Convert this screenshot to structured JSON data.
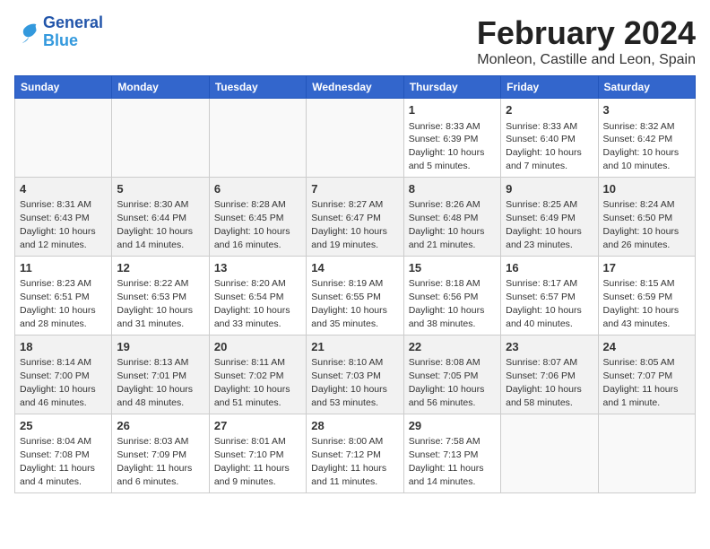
{
  "header": {
    "logo_text_line1": "General",
    "logo_text_line2": "Blue",
    "month": "February 2024",
    "location": "Monleon, Castille and Leon, Spain"
  },
  "weekdays": [
    "Sunday",
    "Monday",
    "Tuesday",
    "Wednesday",
    "Thursday",
    "Friday",
    "Saturday"
  ],
  "weeks": [
    [
      {
        "day": "",
        "info": ""
      },
      {
        "day": "",
        "info": ""
      },
      {
        "day": "",
        "info": ""
      },
      {
        "day": "",
        "info": ""
      },
      {
        "day": "1",
        "info": "Sunrise: 8:33 AM\nSunset: 6:39 PM\nDaylight: 10 hours\nand 5 minutes."
      },
      {
        "day": "2",
        "info": "Sunrise: 8:33 AM\nSunset: 6:40 PM\nDaylight: 10 hours\nand 7 minutes."
      },
      {
        "day": "3",
        "info": "Sunrise: 8:32 AM\nSunset: 6:42 PM\nDaylight: 10 hours\nand 10 minutes."
      }
    ],
    [
      {
        "day": "4",
        "info": "Sunrise: 8:31 AM\nSunset: 6:43 PM\nDaylight: 10 hours\nand 12 minutes."
      },
      {
        "day": "5",
        "info": "Sunrise: 8:30 AM\nSunset: 6:44 PM\nDaylight: 10 hours\nand 14 minutes."
      },
      {
        "day": "6",
        "info": "Sunrise: 8:28 AM\nSunset: 6:45 PM\nDaylight: 10 hours\nand 16 minutes."
      },
      {
        "day": "7",
        "info": "Sunrise: 8:27 AM\nSunset: 6:47 PM\nDaylight: 10 hours\nand 19 minutes."
      },
      {
        "day": "8",
        "info": "Sunrise: 8:26 AM\nSunset: 6:48 PM\nDaylight: 10 hours\nand 21 minutes."
      },
      {
        "day": "9",
        "info": "Sunrise: 8:25 AM\nSunset: 6:49 PM\nDaylight: 10 hours\nand 23 minutes."
      },
      {
        "day": "10",
        "info": "Sunrise: 8:24 AM\nSunset: 6:50 PM\nDaylight: 10 hours\nand 26 minutes."
      }
    ],
    [
      {
        "day": "11",
        "info": "Sunrise: 8:23 AM\nSunset: 6:51 PM\nDaylight: 10 hours\nand 28 minutes."
      },
      {
        "day": "12",
        "info": "Sunrise: 8:22 AM\nSunset: 6:53 PM\nDaylight: 10 hours\nand 31 minutes."
      },
      {
        "day": "13",
        "info": "Sunrise: 8:20 AM\nSunset: 6:54 PM\nDaylight: 10 hours\nand 33 minutes."
      },
      {
        "day": "14",
        "info": "Sunrise: 8:19 AM\nSunset: 6:55 PM\nDaylight: 10 hours\nand 35 minutes."
      },
      {
        "day": "15",
        "info": "Sunrise: 8:18 AM\nSunset: 6:56 PM\nDaylight: 10 hours\nand 38 minutes."
      },
      {
        "day": "16",
        "info": "Sunrise: 8:17 AM\nSunset: 6:57 PM\nDaylight: 10 hours\nand 40 minutes."
      },
      {
        "day": "17",
        "info": "Sunrise: 8:15 AM\nSunset: 6:59 PM\nDaylight: 10 hours\nand 43 minutes."
      }
    ],
    [
      {
        "day": "18",
        "info": "Sunrise: 8:14 AM\nSunset: 7:00 PM\nDaylight: 10 hours\nand 46 minutes."
      },
      {
        "day": "19",
        "info": "Sunrise: 8:13 AM\nSunset: 7:01 PM\nDaylight: 10 hours\nand 48 minutes."
      },
      {
        "day": "20",
        "info": "Sunrise: 8:11 AM\nSunset: 7:02 PM\nDaylight: 10 hours\nand 51 minutes."
      },
      {
        "day": "21",
        "info": "Sunrise: 8:10 AM\nSunset: 7:03 PM\nDaylight: 10 hours\nand 53 minutes."
      },
      {
        "day": "22",
        "info": "Sunrise: 8:08 AM\nSunset: 7:05 PM\nDaylight: 10 hours\nand 56 minutes."
      },
      {
        "day": "23",
        "info": "Sunrise: 8:07 AM\nSunset: 7:06 PM\nDaylight: 10 hours\nand 58 minutes."
      },
      {
        "day": "24",
        "info": "Sunrise: 8:05 AM\nSunset: 7:07 PM\nDaylight: 11 hours\nand 1 minute."
      }
    ],
    [
      {
        "day": "25",
        "info": "Sunrise: 8:04 AM\nSunset: 7:08 PM\nDaylight: 11 hours\nand 4 minutes."
      },
      {
        "day": "26",
        "info": "Sunrise: 8:03 AM\nSunset: 7:09 PM\nDaylight: 11 hours\nand 6 minutes."
      },
      {
        "day": "27",
        "info": "Sunrise: 8:01 AM\nSunset: 7:10 PM\nDaylight: 11 hours\nand 9 minutes."
      },
      {
        "day": "28",
        "info": "Sunrise: 8:00 AM\nSunset: 7:12 PM\nDaylight: 11 hours\nand 11 minutes."
      },
      {
        "day": "29",
        "info": "Sunrise: 7:58 AM\nSunset: 7:13 PM\nDaylight: 11 hours\nand 14 minutes."
      },
      {
        "day": "",
        "info": ""
      },
      {
        "day": "",
        "info": ""
      }
    ]
  ]
}
